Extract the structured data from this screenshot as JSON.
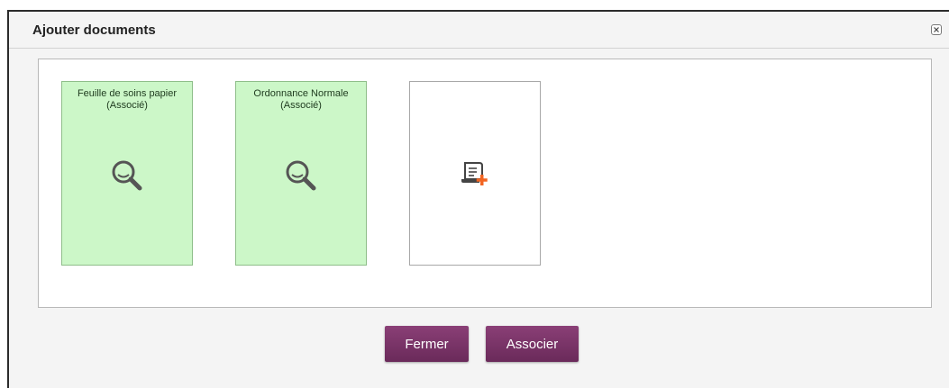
{
  "dialog": {
    "title": "Ajouter documents",
    "close_icon": "close-icon"
  },
  "documents": [
    {
      "name_line1": "Feuille de soins papier",
      "name_line2": "(Associé)",
      "icon": "magnifier-icon",
      "status": "associated"
    },
    {
      "name_line1": "Ordonnance Normale",
      "name_line2": "(Associé)",
      "icon": "magnifier-icon",
      "status": "associated"
    }
  ],
  "add_card": {
    "icon": "add-document-icon"
  },
  "buttons": {
    "close_label": "Fermer",
    "associate_label": "Associer"
  },
  "colors": {
    "associated_bg": "#ccf7c8",
    "button_bg": "#7a3468",
    "add_accent": "#f26522"
  }
}
